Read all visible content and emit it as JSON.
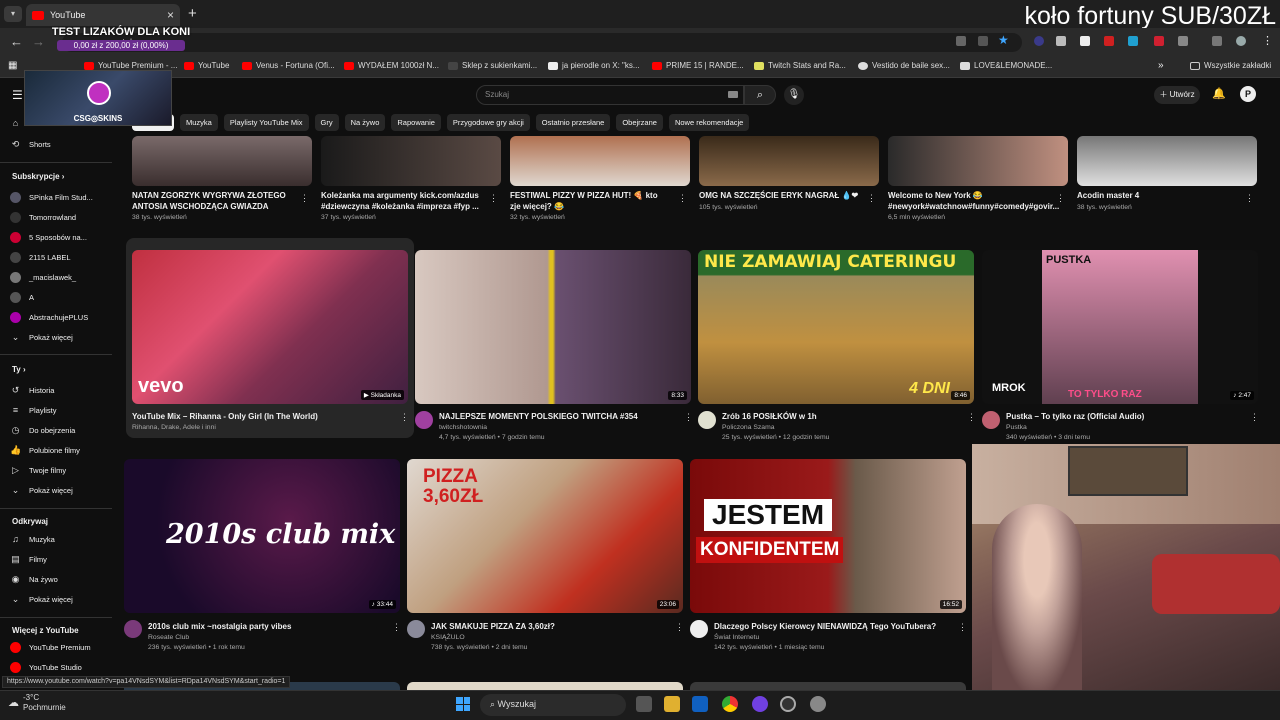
{
  "browser": {
    "tab_title": "YouTube",
    "url": "youtube.com",
    "status_url": "https://www.youtube.com/watch?v=pa14VNsdSYM&list=RDpa14VNsdSYM&start_radio=1",
    "bookmarks": [
      "YouTube Premium - ...",
      "YouTube",
      "Venus - Fortuna (Ofi...",
      "WYDAŁEM 1000zł N...",
      "Sklep z sukienkami...",
      "ja pierodle on X: \"ks...",
      "PRIME 15 | RANDE...",
      "Twitch Stats and Ra...",
      "Vestido de baile sex...",
      "LOVE&LEMONADE..."
    ],
    "bookmarks_folder": "Wszystkie zakładki"
  },
  "stream_overlay": {
    "title": "koło fortuny SUB/30ZŁ",
    "donation_title": "TEST LIZAKÓW DLA KONI",
    "donation_progress": "0,00 zł z 200,00 zł (0,00%)",
    "sponsor": "CSG◎SKINS"
  },
  "youtube": {
    "search_placeholder": "Szukaj",
    "create_label": "Utwórz",
    "chips": [
      "",
      "Muzyka",
      "Playlisty YouTube Mix",
      "Gry",
      "Na żywo",
      "Rapowanie",
      "Przygodowe gry akcji",
      "Ostatnio przesłane",
      "Obejrzane",
      "Nowe rekomendacje"
    ]
  },
  "sidebar": {
    "shorts": "Shorts",
    "subs_header": "Subskrypcje",
    "subs": [
      "SPinka Film Stud...",
      "Tomorrowland",
      "5 Sposobów na...",
      "2115 LABEL",
      "_macislawek_",
      "A",
      "AbstrachujePLUS"
    ],
    "show_more": "Pokaż więcej",
    "you_header": "Ty",
    "you_items": [
      "Historia",
      "Playlisty",
      "Do obejrzenia",
      "Polubione filmy",
      "Twoje filmy",
      "Pokaż więcej"
    ],
    "explore_header": "Odkrywaj",
    "explore_items": [
      "Muzyka",
      "Filmy",
      "Na żywo",
      "Pokaż więcej"
    ],
    "more_header": "Więcej z YouTube",
    "more_items": [
      "YouTube Premium",
      "YouTube Studio"
    ]
  },
  "row1": [
    {
      "title": "NATAN ZGORZYK WYGRYWA ZŁOTEGO ANTOSIA WSCHODZĄCA GWIAZDA",
      "meta": "38 tys. wyświetleń"
    },
    {
      "title": "Koleżanka ma argumenty kick.com/azdus #dziewczyna #koleżanka #impreza #fyp ...",
      "meta": "37 tys. wyświetleń"
    },
    {
      "title": "FESTIWAL PIZZY W PIZZA HUT! 🍕 kto zje więcej? 😂",
      "meta": "32 tys. wyświetleń"
    },
    {
      "title": "OMG NA SZCZĘŚCIE ERYK NAGRAŁ 💧❤",
      "meta": "105 tys. wyświetleń"
    },
    {
      "title": "Welcome to New York 😂 #newyork#watchnow#funny#comedy#govir...",
      "meta": "6,5 mln wyświetleń"
    },
    {
      "title": "Acodin master 4",
      "meta": "38 tys. wyświetleń"
    }
  ],
  "row2": [
    {
      "title": "YouTube Mix – Rihanna - Only Girl (In The World)",
      "channel": "Rihanna, Drake, Adele i inni",
      "meta": "",
      "duration": "▶ Składanka",
      "thumb_text": "vevo"
    },
    {
      "title": "NAJLEPSZE MOMENTY POLSKIEGO TWITCHA #354",
      "channel": "twitchshotownia",
      "meta": "4,7 tys. wyświetleń • 7 godzin temu",
      "duration": "8:33",
      "thumb_text": ""
    },
    {
      "title": "Zrób 16 POSIŁKÓW w 1h",
      "channel": "Policzona Szama",
      "meta": "25 tys. wyświetleń • 12 godzin temu",
      "duration": "8:46",
      "thumb_text": "NIE ZAMAWIAJ CATERINGU",
      "thumb_text2": "4 DNI"
    },
    {
      "title": "Pustka – To tylko raz (Official Audio)",
      "channel": "Pustka",
      "meta": "340 wyświetleń • 3 dni temu",
      "duration": "♪ 2:47",
      "thumb_text": "PUSTKA",
      "thumb_text2": "TO TYLKO RAZ",
      "thumb_text3": "MROK"
    }
  ],
  "row3": [
    {
      "title": "2010s club mix ~nostalgia party vibes",
      "channel": "Roseate Club",
      "meta": "236 tys. wyświetleń • 1 rok temu",
      "duration": "♪ 33:44",
      "thumb_text": "2010s club mix"
    },
    {
      "title": "JAK SMAKUJE PIZZA ZA 3,60zł?",
      "channel": "KSIĄŻULO",
      "meta": "738 tys. wyświetleń • 2 dni temu",
      "duration": "23:06",
      "thumb_text": "PIZZA 3,60ZŁ"
    },
    {
      "title": "Dlaczego Polscy Kierowcy NIENAWIDZĄ Tego YouTubera?",
      "channel": "Świat Internetu",
      "meta": "142 tys. wyświetleń • 1 miesiąc temu",
      "duration": "16:52",
      "thumb_text": "JESTEM",
      "thumb_text2": "KONFIDENTEM"
    }
  ],
  "taskbar": {
    "temp": "-3°C",
    "weather": "Pochmurnie",
    "search": "Wyszukaj"
  }
}
